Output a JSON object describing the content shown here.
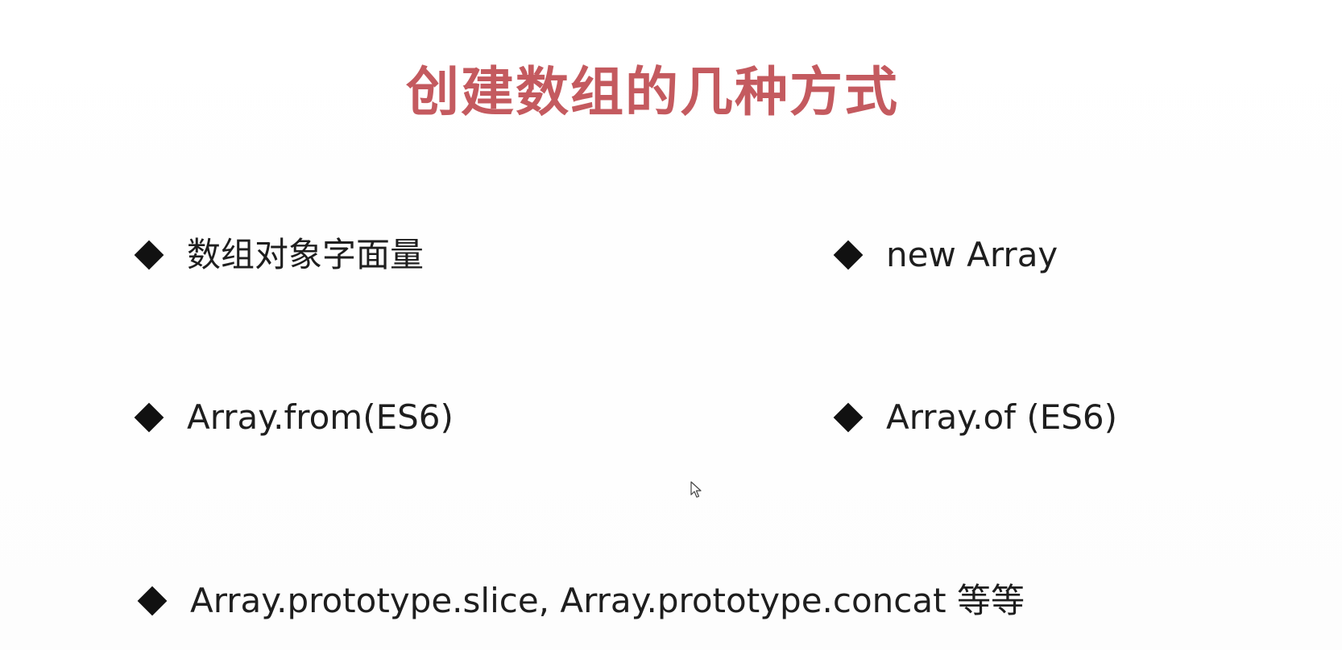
{
  "slide": {
    "title": "创建数组的几种方式",
    "title_color": "#c45a5f",
    "bullet_icon": "diamond-bullet-icon",
    "items": [
      {
        "label": "数组对象字面量"
      },
      {
        "label": "new Array"
      },
      {
        "label": "Array.from(ES6)"
      },
      {
        "label": "Array.of (ES6)"
      },
      {
        "label": "Array.prototype.slice, Array.prototype.concat 等等"
      }
    ]
  }
}
